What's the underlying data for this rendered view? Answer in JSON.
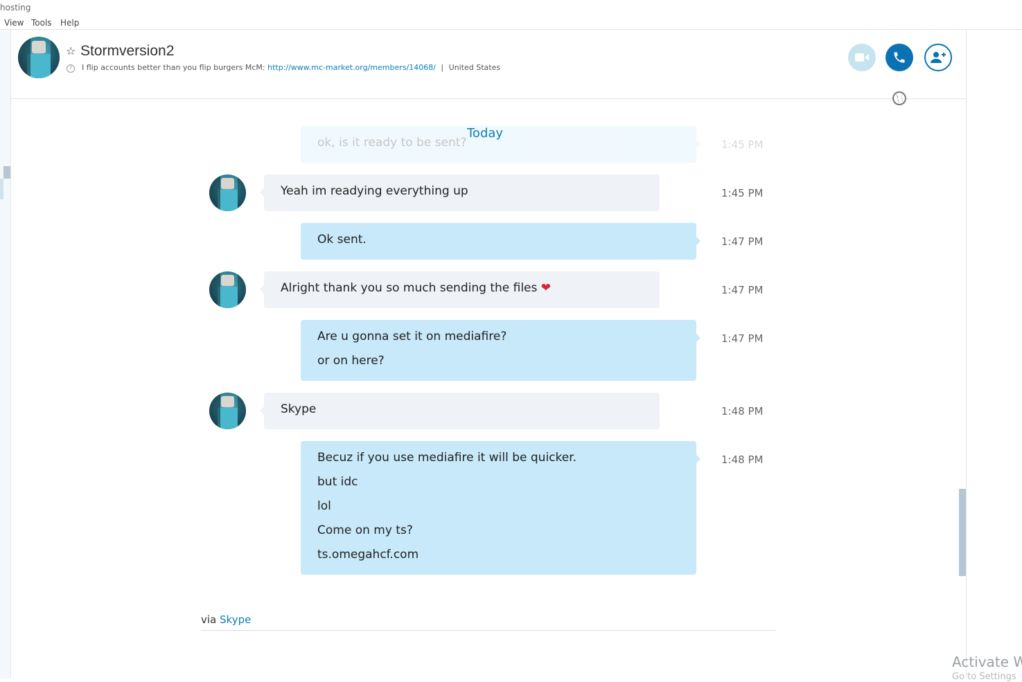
{
  "window": {
    "title_fragment": "hosting"
  },
  "menu": [
    "View",
    "Tools",
    "Help"
  ],
  "contact": {
    "name": "Stormversion2",
    "mood_text": "I flip accounts better than you flip burgers McM:",
    "mood_link": "http://www.mc-market.org/members/14068/",
    "separator": "|",
    "location": "United States"
  },
  "header_actions": {
    "video": "video-call",
    "call": "voice-call",
    "add": "add-people"
  },
  "date_divider": "Today",
  "messages": [
    {
      "from": "me",
      "lines": [
        "ok, is it ready to be sent?"
      ],
      "time": "1:45 PM",
      "faded": true
    },
    {
      "from": "contact",
      "lines": [
        "Yeah im readying everything up"
      ],
      "time": "1:45 PM"
    },
    {
      "from": "me",
      "lines": [
        "Ok sent."
      ],
      "time": "1:47 PM"
    },
    {
      "from": "contact",
      "lines": [
        "Alright thank you so much sending the files"
      ],
      "time": "1:47 PM",
      "emoji": "❤"
    },
    {
      "from": "me",
      "lines": [
        "Are u gonna set it on mediafire?",
        "or on here?"
      ],
      "time": "1:47 PM"
    },
    {
      "from": "contact",
      "lines": [
        "Skype"
      ],
      "time": "1:48 PM"
    },
    {
      "from": "me",
      "lines": [
        "Becuz if you use mediafire it will be quicker.",
        "but idc",
        "lol",
        "Come on my ts?",
        "ts.omegahcf.com"
      ],
      "time": "1:48 PM"
    }
  ],
  "footer": {
    "via": "via",
    "service": "Skype"
  },
  "watermark": {
    "line1": "Activate Wi",
    "line2": "Go to Settings"
  },
  "colors": {
    "accent": "#0a72b4",
    "outgoing": "#c7e9fa",
    "incoming": "#eff2f6",
    "link": "#0d7fb8"
  }
}
